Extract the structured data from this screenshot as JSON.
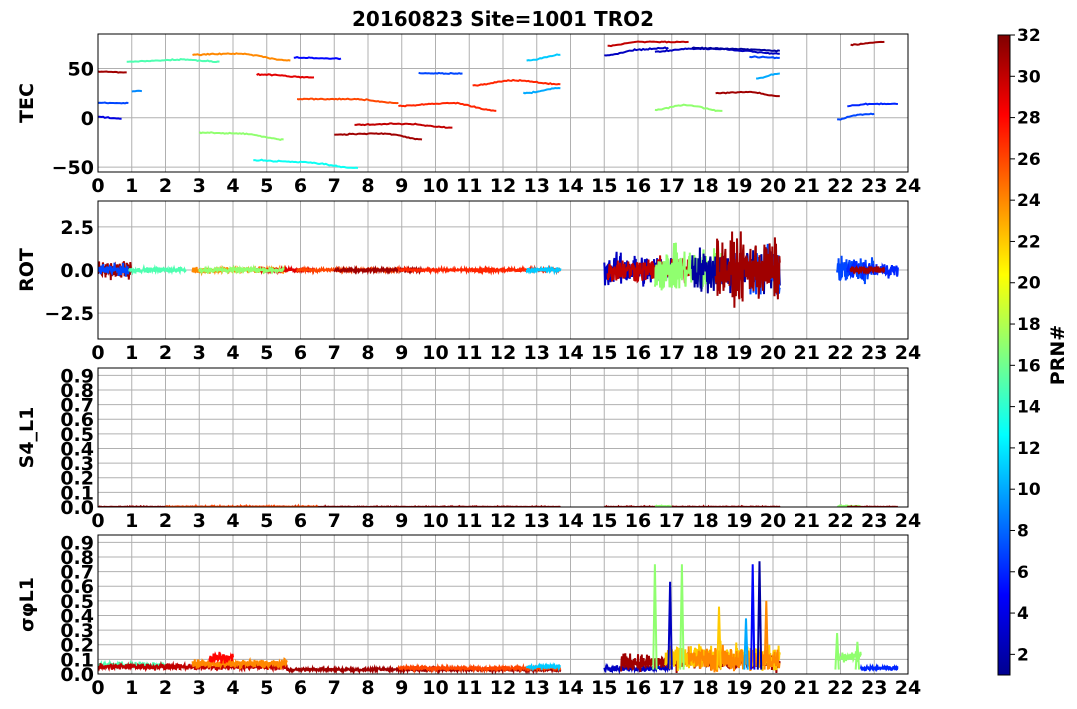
{
  "title": "20160823 Site=1001 TRO2",
  "x_tick_labels": [
    "0",
    "1",
    "2",
    "3",
    "4",
    "5",
    "6",
    "7",
    "8",
    "9",
    "10",
    "11",
    "12",
    "13",
    "14",
    "15",
    "16",
    "17",
    "18",
    "19",
    "20",
    "21",
    "22",
    "23",
    "24"
  ],
  "colorbar": {
    "label": "PRN#",
    "range": [
      1,
      32
    ],
    "tick_values": [
      2,
      4,
      6,
      8,
      10,
      12,
      14,
      16,
      18,
      20,
      22,
      24,
      26,
      28,
      30,
      32
    ],
    "colormap": "jet"
  },
  "chart_data": [
    {
      "type": "line",
      "ylabel": "TEC",
      "xlim": [
        0,
        24
      ],
      "ylim": [
        -55,
        85
      ],
      "yticks": [
        -50,
        0,
        50
      ],
      "ytick_labels": [
        "−50",
        "0",
        "50"
      ],
      "grid": true,
      "series": [
        {
          "prn": 31,
          "x": [
            0.0,
            0.85
          ],
          "y": [
            47,
            46
          ]
        },
        {
          "prn": 7,
          "x": [
            0.0,
            0.9
          ],
          "y": [
            15,
            15
          ]
        },
        {
          "prn": 4,
          "x": [
            0.0,
            0.7
          ],
          "y": [
            1,
            -1
          ]
        },
        {
          "prn": 9,
          "x": [
            1.0,
            1.3
          ],
          "y": [
            27,
            27
          ]
        },
        {
          "prn": 15,
          "x": [
            0.85,
            2.5,
            3.6
          ],
          "y": [
            57,
            59,
            57
          ]
        },
        {
          "prn": 24,
          "x": [
            2.8,
            4.2,
            5.7
          ],
          "y": [
            64,
            65,
            58
          ]
        },
        {
          "prn": 17,
          "x": [
            3.0,
            4.3,
            5.5
          ],
          "y": [
            -15,
            -16,
            -22
          ]
        },
        {
          "prn": 13,
          "x": [
            4.6,
            6.0,
            7.7
          ],
          "y": [
            -43,
            -45,
            -51
          ]
        },
        {
          "prn": 29,
          "x": [
            4.7,
            6.4
          ],
          "y": [
            44,
            41
          ]
        },
        {
          "prn": 5,
          "x": [
            5.8,
            7.2
          ],
          "y": [
            61,
            60
          ]
        },
        {
          "prn": 26,
          "x": [
            5.9,
            7.5,
            8.9
          ],
          "y": [
            19,
            19,
            15
          ]
        },
        {
          "prn": 31,
          "x": [
            7.0,
            8.5,
            9.6
          ],
          "y": [
            -17,
            -16,
            -22
          ]
        },
        {
          "prn": 30,
          "x": [
            7.6,
            9.0,
            10.5
          ],
          "y": [
            -7,
            -6,
            -10
          ]
        },
        {
          "prn": 7,
          "x": [
            9.5,
            10.8
          ],
          "y": [
            45,
            45
          ]
        },
        {
          "prn": 27,
          "x": [
            8.9,
            10.5,
            11.8
          ],
          "y": [
            12,
            15,
            7
          ]
        },
        {
          "prn": 27,
          "x": [
            11.1,
            12.3,
            13.7
          ],
          "y": [
            33,
            38,
            34
          ]
        },
        {
          "prn": 10,
          "x": [
            12.6,
            13.7
          ],
          "y": [
            25,
            30
          ]
        },
        {
          "prn": 11,
          "x": [
            12.7,
            13.7
          ],
          "y": [
            58,
            64
          ]
        },
        {
          "prn": 3,
          "x": [
            15.0,
            16.0,
            16.9
          ],
          "y": [
            63,
            69,
            71
          ]
        },
        {
          "prn": 30,
          "x": [
            15.1,
            16.0,
            17.5
          ],
          "y": [
            73,
            77,
            77
          ]
        },
        {
          "prn": 3,
          "x": [
            16.5,
            17.5,
            18.5,
            19.0,
            20.2
          ],
          "y": [
            67,
            70,
            70,
            68,
            65
          ]
        },
        {
          "prn": 2,
          "x": [
            17.6,
            18.8,
            20.2
          ],
          "y": [
            71,
            70,
            68
          ]
        },
        {
          "prn": 7,
          "x": [
            19.3,
            20.2
          ],
          "y": [
            62,
            61
          ]
        },
        {
          "prn": 10,
          "x": [
            19.5,
            20.2
          ],
          "y": [
            40,
            45
          ]
        },
        {
          "prn": 31,
          "x": [
            18.3,
            19.3,
            20.2
          ],
          "y": [
            25,
            26,
            22
          ]
        },
        {
          "prn": 17,
          "x": [
            16.5,
            17.4,
            18.5
          ],
          "y": [
            8,
            13,
            7
          ]
        },
        {
          "prn": 31,
          "x": [
            22.3,
            23.3
          ],
          "y": [
            74,
            77
          ]
        },
        {
          "prn": 6,
          "x": [
            22.2,
            22.8,
            23.7
          ],
          "y": [
            12,
            14,
            14
          ]
        },
        {
          "prn": 7,
          "x": [
            21.9,
            22.5,
            23.0
          ],
          "y": [
            -2,
            3,
            4
          ]
        }
      ]
    },
    {
      "type": "line",
      "ylabel": "ROT",
      "xlim": [
        0,
        24
      ],
      "ylim": [
        -4,
        4
      ],
      "yticks": [
        -2.5,
        0.0,
        2.5
      ],
      "ytick_labels": [
        "−2.5",
        "0.0",
        "2.5"
      ],
      "grid": true,
      "segments": [
        {
          "prn": 31,
          "x": [
            0.0,
            1.0
          ],
          "amp": 0.7
        },
        {
          "prn": 7,
          "x": [
            0.0,
            0.9
          ],
          "amp": 0.5
        },
        {
          "prn": 15,
          "x": [
            0.9,
            2.6
          ],
          "amp": 0.2
        },
        {
          "prn": 24,
          "x": [
            2.8,
            5.6
          ],
          "amp": 0.25
        },
        {
          "prn": 29,
          "x": [
            4.7,
            6.4
          ],
          "amp": 0.15
        },
        {
          "prn": 17,
          "x": [
            3.0,
            5.5
          ],
          "amp": 0.2
        },
        {
          "prn": 26,
          "x": [
            5.9,
            8.9
          ],
          "amp": 0.12
        },
        {
          "prn": 31,
          "x": [
            7.0,
            9.6
          ],
          "amp": 0.15
        },
        {
          "prn": 27,
          "x": [
            8.9,
            11.8
          ],
          "amp": 0.12
        },
        {
          "prn": 27,
          "x": [
            11.1,
            13.7
          ],
          "amp": 0.15
        },
        {
          "prn": 11,
          "x": [
            12.7,
            13.7
          ],
          "amp": 0.2
        },
        {
          "prn": 3,
          "x": [
            15.0,
            17.0
          ],
          "amp": 1.3
        },
        {
          "prn": 30,
          "x": [
            15.1,
            17.5
          ],
          "amp": 1.0
        },
        {
          "prn": 17,
          "x": [
            16.5,
            18.5
          ],
          "amp": 1.8
        },
        {
          "prn": 2,
          "x": [
            17.6,
            20.2
          ],
          "amp": 1.8
        },
        {
          "prn": 7,
          "x": [
            19.3,
            20.2
          ],
          "amp": 2.5
        },
        {
          "prn": 31,
          "x": [
            18.3,
            20.2
          ],
          "amp": 2.5
        },
        {
          "prn": 7,
          "x": [
            21.9,
            23.0
          ],
          "amp": 1.1
        },
        {
          "prn": 6,
          "x": [
            22.2,
            23.7
          ],
          "amp": 0.6
        },
        {
          "prn": 31,
          "x": [
            22.3,
            23.3
          ],
          "amp": 0.3
        }
      ]
    },
    {
      "type": "line",
      "ylabel": "S4_L1",
      "xlim": [
        0,
        24
      ],
      "ylim": [
        0,
        0.95
      ],
      "yticks": [
        0.0,
        0.1,
        0.2,
        0.3,
        0.4,
        0.5,
        0.6,
        0.7,
        0.8,
        0.9
      ],
      "ytick_labels": [
        "0.0",
        "0.1",
        "0.2",
        "0.3",
        "0.4",
        "0.5",
        "0.6",
        "0.7",
        "0.8",
        "0.9"
      ],
      "grid": true,
      "segments": [
        {
          "prn": 31,
          "x": [
            0.0,
            13.7
          ],
          "level": 0.0,
          "amp": 0.005
        },
        {
          "prn": 26,
          "x": [
            2.0,
            6.5
          ],
          "level": 0.0,
          "amp": 0.008
        },
        {
          "prn": 31,
          "x": [
            15.0,
            20.2
          ],
          "level": 0.0,
          "amp": 0.005
        },
        {
          "prn": 17,
          "x": [
            16.5,
            17.0
          ],
          "level": 0.005,
          "amp": 0.005
        },
        {
          "prn": 17,
          "x": [
            21.9,
            22.6
          ],
          "level": 0.005,
          "amp": 0.005
        },
        {
          "prn": 31,
          "x": [
            22.2,
            23.7
          ],
          "level": 0.0,
          "amp": 0.005
        }
      ]
    },
    {
      "type": "line",
      "ylabel": "σφL1",
      "xlim": [
        0,
        24
      ],
      "ylim": [
        0,
        0.95
      ],
      "yticks": [
        0.0,
        0.1,
        0.2,
        0.3,
        0.4,
        0.5,
        0.6,
        0.7,
        0.8,
        0.9
      ],
      "ytick_labels": [
        "0.0",
        "0.1",
        "0.2",
        "0.3",
        "0.4",
        "0.5",
        "0.6",
        "0.7",
        "0.8",
        "0.9"
      ],
      "grid": true,
      "segments": [
        {
          "prn": 15,
          "x": [
            0.0,
            2.0
          ],
          "level": 0.06,
          "amp": 0.03
        },
        {
          "prn": 30,
          "x": [
            0.0,
            5.6
          ],
          "level": 0.05,
          "amp": 0.03
        },
        {
          "prn": 24,
          "x": [
            2.8,
            5.6
          ],
          "level": 0.07,
          "amp": 0.04
        },
        {
          "prn": 28,
          "x": [
            3.3,
            4.0
          ],
          "level": 0.11,
          "amp": 0.05
        },
        {
          "prn": 31,
          "x": [
            5.6,
            13.7
          ],
          "level": 0.03,
          "amp": 0.015
        },
        {
          "prn": 26,
          "x": [
            8.9,
            13.7
          ],
          "level": 0.04,
          "amp": 0.02
        },
        {
          "prn": 11,
          "x": [
            12.7,
            13.7
          ],
          "level": 0.05,
          "amp": 0.02
        },
        {
          "prn": 3,
          "x": [
            15.0,
            17.0
          ],
          "level": 0.04,
          "amp": 0.03
        },
        {
          "prn": 31,
          "x": [
            15.5,
            20.2
          ],
          "level": 0.08,
          "amp": 0.08
        },
        {
          "prn": 22,
          "x": [
            16.8,
            20.2
          ],
          "level": 0.12,
          "amp": 0.12
        },
        {
          "prn": 24,
          "x": [
            17.5,
            20.2
          ],
          "level": 0.1,
          "amp": 0.12
        },
        {
          "prn": 17,
          "x": [
            21.9,
            22.6
          ],
          "level": 0.12,
          "amp": 0.05
        },
        {
          "prn": 6,
          "x": [
            22.6,
            23.7
          ],
          "level": 0.04,
          "amp": 0.02
        }
      ],
      "spikes": [
        {
          "prn": 17,
          "x": 16.5,
          "y": 0.75
        },
        {
          "prn": 17,
          "x": 17.3,
          "y": 0.75
        },
        {
          "prn": 3,
          "x": 16.95,
          "y": 0.63
        },
        {
          "prn": 22,
          "x": 18.4,
          "y": 0.46
        },
        {
          "prn": 5,
          "x": 19.4,
          "y": 0.75
        },
        {
          "prn": 2,
          "x": 19.6,
          "y": 0.77
        },
        {
          "prn": 24,
          "x": 19.8,
          "y": 0.5
        },
        {
          "prn": 10,
          "x": 19.2,
          "y": 0.38
        },
        {
          "prn": 17,
          "x": 21.9,
          "y": 0.28
        },
        {
          "prn": 17,
          "x": 22.5,
          "y": 0.22
        }
      ]
    }
  ]
}
